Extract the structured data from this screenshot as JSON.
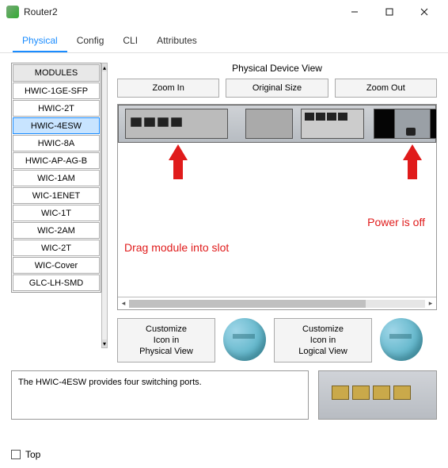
{
  "window": {
    "title": "Router2"
  },
  "tabs": [
    {
      "label": "Physical",
      "active": true
    },
    {
      "label": "Config"
    },
    {
      "label": "CLI"
    },
    {
      "label": "Attributes"
    }
  ],
  "modules": {
    "header": "MODULES",
    "items": [
      {
        "label": "HWIC-1GE-SFP"
      },
      {
        "label": "HWIC-2T"
      },
      {
        "label": "HWIC-4ESW",
        "selected": true
      },
      {
        "label": "HWIC-8A"
      },
      {
        "label": "HWIC-AP-AG-B"
      },
      {
        "label": "WIC-1AM"
      },
      {
        "label": "WIC-1ENET"
      },
      {
        "label": "WIC-1T"
      },
      {
        "label": "WIC-2AM"
      },
      {
        "label": "WIC-2T"
      },
      {
        "label": "WIC-Cover"
      },
      {
        "label": "GLC-LH-SMD"
      }
    ]
  },
  "device_view": {
    "title": "Physical Device View",
    "zoom_in": "Zoom In",
    "original": "Original Size",
    "zoom_out": "Zoom Out",
    "annotation_drag": "Drag module into slot",
    "annotation_power": "Power is off"
  },
  "customize": {
    "physical_line1": "Customize",
    "physical_line2": "Icon in",
    "physical_line3": "Physical View",
    "logical_line1": "Customize",
    "logical_line2": "Icon in",
    "logical_line3": "Logical View"
  },
  "description": "The HWIC-4ESW provides four switching ports.",
  "footer": {
    "top_label": "Top"
  }
}
